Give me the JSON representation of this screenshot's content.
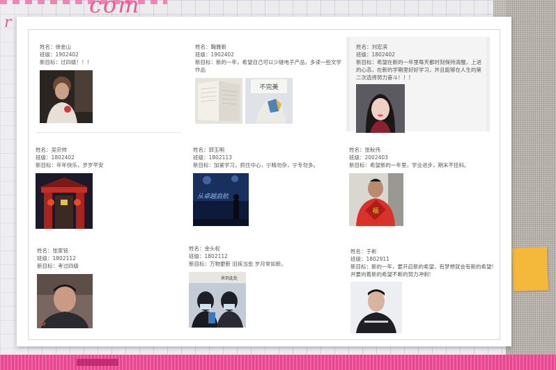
{
  "decor": {
    "brand_text": "com",
    "corner_text": "r"
  },
  "students": [
    {
      "name": "姓名：徐金山",
      "class": "班级：1902402",
      "goal": "新目标：过四级！！！"
    },
    {
      "name": "姓名：鞠雅新",
      "class": "班级：1902402",
      "goal": "新目标：新的一年，希望自己可以少碰电子产品，多读一些文学作品"
    },
    {
      "name": "姓名：刘宏滨",
      "class": "班级：1802402",
      "goal": "新目标：希望在新的一年里每天都时刻保持清醒，上进的心态，在新的学期里好好学习，并且能够在人生的第二次选择努力奋斗！！！"
    },
    {
      "name": "姓名：吴宗帅",
      "class": "班级：1802402",
      "goal": "新目标：年年快乐，岁岁平安"
    },
    {
      "name": "姓名：郭玉明",
      "class": "班级：1802113",
      "goal": "新目标：加紧学习，抓住中心，宁精勿杂，宁专勿多。"
    },
    {
      "name": "姓名：张秋伟",
      "class": "班级：2002403",
      "goal": "新目标：希望新的一年里，学业进步，期末不挂科。"
    },
    {
      "name": "姓名：张家铭",
      "class": "班级：1802112",
      "goal": "新目标：考过四级"
    },
    {
      "name": "姓名：金头权",
      "class": "班级：1802112",
      "goal": "新目标：万物更新 旧疾当愈 岁月常如新。"
    },
    {
      "name": "姓名：于彬",
      "class": "班级：1802911",
      "goal": "新目标：新的一年，要开启新的希望，有梦想就会有新的希望!并要向着新的希望不断的努力冲刺!"
    }
  ],
  "photo_texts": {
    "book_caption": "不完美",
    "night_banner": "从卓越启航",
    "couple_caption": "来到此处"
  },
  "colors": {
    "pink": "#e8468f",
    "sticky": "#f4b83a"
  }
}
